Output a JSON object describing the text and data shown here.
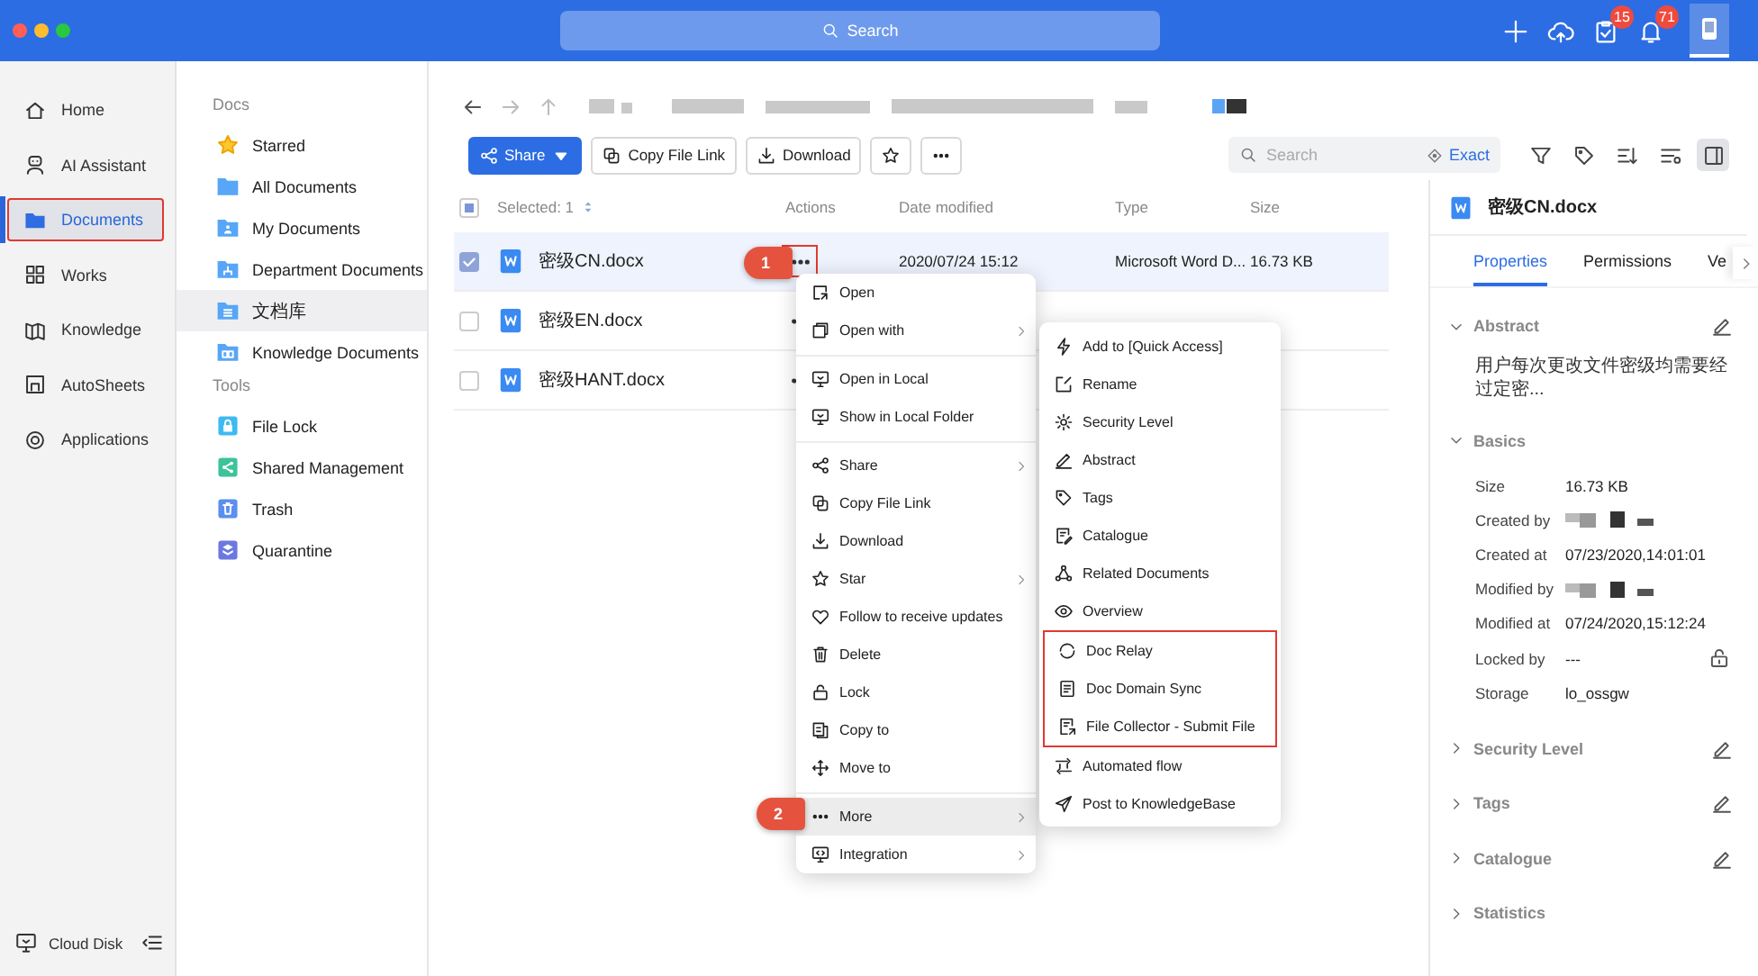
{
  "titlebar": {
    "search_placeholder": "Search",
    "actions": [
      {
        "kind": "plus"
      },
      {
        "kind": "cloud"
      },
      {
        "kind": "clipboard",
        "badge": "15"
      },
      {
        "kind": "bell",
        "badge": "71"
      },
      {
        "kind": "profile"
      }
    ]
  },
  "rail": {
    "items": [
      {
        "kind": "home",
        "label": "Home",
        "selected": false,
        "outlined": false
      },
      {
        "kind": "robot",
        "label": "AI Assistant",
        "selected": false,
        "outlined": false
      },
      {
        "kind": "folder",
        "label": "Documents",
        "selected": true,
        "outlined": true
      },
      {
        "kind": "grid",
        "label": "Works",
        "selected": false,
        "outlined": false
      },
      {
        "kind": "book",
        "label": "Knowledge",
        "selected": false,
        "outlined": false
      },
      {
        "kind": "sheet",
        "label": "AutoSheets",
        "selected": false,
        "outlined": false
      },
      {
        "kind": "ring",
        "label": "Applications",
        "selected": false,
        "outlined": false
      }
    ],
    "footer": {
      "kind": "monitor",
      "label": "Cloud Disk"
    }
  },
  "docs_nav": {
    "sections": [
      {
        "title": "Docs",
        "items": [
          {
            "kind": "star-tile",
            "label": "Starred",
            "selected": false
          },
          {
            "kind": "folder-tile",
            "label": "All Documents",
            "selected": false
          },
          {
            "kind": "folder-user",
            "label": "My Documents",
            "selected": false
          },
          {
            "kind": "folder-tree",
            "label": "Department Documents",
            "selected": false
          },
          {
            "kind": "folder-list",
            "label": "文档库",
            "selected": true
          },
          {
            "kind": "folder-book",
            "label": "Knowledge Documents",
            "selected": false
          }
        ]
      },
      {
        "title": "Tools",
        "items": [
          {
            "kind": "lock-tile",
            "label": "File Lock",
            "selected": false
          },
          {
            "kind": "share-tile",
            "label": "Shared Management",
            "selected": false
          },
          {
            "kind": "trash-tile",
            "label": "Trash",
            "selected": false
          },
          {
            "kind": "shield-tile",
            "label": "Quarantine",
            "selected": false
          }
        ]
      }
    ]
  },
  "toolbar": {
    "buttons": [
      {
        "kind": "share",
        "label": "Share"
      },
      {
        "kind": "copy",
        "label": "Copy File Link"
      },
      {
        "kind": "download",
        "label": "Download"
      },
      {
        "kind": "star"
      },
      {
        "kind": "more"
      }
    ],
    "search": {
      "placeholder": "Search",
      "exact": "Exact"
    },
    "tools": [
      {
        "kind": "filter",
        "selected": false
      },
      {
        "kind": "tag",
        "selected": false
      },
      {
        "kind": "sort",
        "selected": false
      },
      {
        "kind": "sliders",
        "selected": false
      },
      {
        "kind": "panel",
        "selected": true
      }
    ]
  },
  "table": {
    "indeterminate": true,
    "columns": [
      "Selected: 1",
      "Actions",
      "Date modified",
      "Type",
      "Size"
    ],
    "rows": [
      {
        "name": "密级CN.docx",
        "checked": true,
        "selected": true,
        "actions_outlined": true,
        "date": "2020/07/24 15:12",
        "type": "Microsoft Word D...",
        "size": "16.73 KB"
      },
      {
        "name": "密级EN.docx",
        "checked": false,
        "selected": false,
        "actions_outlined": false
      },
      {
        "name": "密级HANT.docx",
        "checked": false,
        "selected": false,
        "actions_outlined": false
      }
    ]
  },
  "menu": {
    "groups": [
      [
        {
          "kind": "open",
          "label": "Open",
          "submenu": false,
          "highlighted": false
        },
        {
          "kind": "window",
          "label": "Open with",
          "submenu": true,
          "highlighted": false
        }
      ],
      [
        {
          "kind": "monitor",
          "label": "Open in Local",
          "submenu": false,
          "highlighted": false
        },
        {
          "kind": "monitor",
          "label": "Show in Local Folder",
          "submenu": false,
          "highlighted": false
        }
      ],
      [
        {
          "kind": "share",
          "label": "Share",
          "submenu": true,
          "highlighted": false
        },
        {
          "kind": "copy",
          "label": "Copy File Link",
          "submenu": false,
          "highlighted": false
        },
        {
          "kind": "download",
          "label": "Download",
          "submenu": false,
          "highlighted": false
        },
        {
          "kind": "star",
          "label": "Star",
          "submenu": true,
          "highlighted": false
        },
        {
          "kind": "heart",
          "label": "Follow to receive updates",
          "submenu": false,
          "highlighted": false
        },
        {
          "kind": "trash",
          "label": "Delete",
          "submenu": false,
          "highlighted": false
        },
        {
          "kind": "lock",
          "label": "Lock",
          "submenu": false,
          "highlighted": false
        },
        {
          "kind": "copyto",
          "label": "Copy to",
          "submenu": false,
          "highlighted": false
        },
        {
          "kind": "move",
          "label": "Move to",
          "submenu": false,
          "highlighted": false
        }
      ],
      [
        {
          "kind": "more",
          "label": "More",
          "submenu": true,
          "highlighted": true
        },
        {
          "kind": "integration",
          "label": "Integration",
          "submenu": true,
          "highlighted": false
        }
      ]
    ]
  },
  "submenu": {
    "sections": [
      {
        "outlined": false,
        "items": [
          {
            "kind": "bolt",
            "label": "Add to [Quick Access]"
          },
          {
            "kind": "rename",
            "label": "Rename"
          },
          {
            "kind": "gear",
            "label": "Security Level"
          },
          {
            "kind": "pen",
            "label": "Abstract"
          },
          {
            "kind": "tag",
            "label": "Tags"
          },
          {
            "kind": "catalogue",
            "label": "Catalogue"
          },
          {
            "kind": "nodes",
            "label": "Related Documents"
          },
          {
            "kind": "eye",
            "label": "Overview"
          }
        ]
      },
      {
        "outlined": true,
        "items": [
          {
            "kind": "relay",
            "label": "Doc Relay"
          },
          {
            "kind": "sync",
            "label": "Doc Domain Sync"
          },
          {
            "kind": "collector",
            "label": "File Collector - Submit File"
          }
        ]
      },
      {
        "outlined": false,
        "items": [
          {
            "kind": "flow",
            "label": "Automated flow"
          },
          {
            "kind": "send",
            "label": "Post to KnowledgeBase"
          }
        ]
      }
    ]
  },
  "annotations": [
    {
      "label": "1"
    },
    {
      "label": "2"
    }
  ],
  "panel": {
    "file_name": "密级CN.docx",
    "tabs": [
      {
        "label": "Properties",
        "selected": true
      },
      {
        "label": "Permissions",
        "selected": false
      },
      {
        "label": "Ve",
        "selected": false
      }
    ],
    "sections": [
      {
        "title": "Abstract",
        "expanded": true,
        "editable": true,
        "text": "用户每次更改文件密级均需要经过定密..."
      },
      {
        "title": "Basics",
        "expanded": true,
        "editable": false,
        "fields": [
          {
            "label": "Size",
            "value": "16.73 KB",
            "redacted": false
          },
          {
            "label": "Created by",
            "redacted": true
          },
          {
            "label": "Created at",
            "value": "07/23/2020,14:01:01",
            "redacted": false
          },
          {
            "label": "Modified by",
            "redacted": true
          },
          {
            "label": "Modified at",
            "value": "07/24/2020,15:12:24",
            "redacted": false
          },
          {
            "label": "Locked by",
            "value": "---",
            "redacted": false,
            "kind": "lock"
          },
          {
            "label": "Storage",
            "value": "lo_ossgw",
            "redacted": false
          }
        ]
      },
      {
        "title": "Security Level",
        "expanded": false,
        "editable": true
      },
      {
        "title": "Tags",
        "expanded": false,
        "editable": true
      },
      {
        "title": "Catalogue",
        "expanded": false,
        "editable": true
      },
      {
        "title": "Statistics",
        "expanded": false,
        "editable": false
      }
    ]
  }
}
